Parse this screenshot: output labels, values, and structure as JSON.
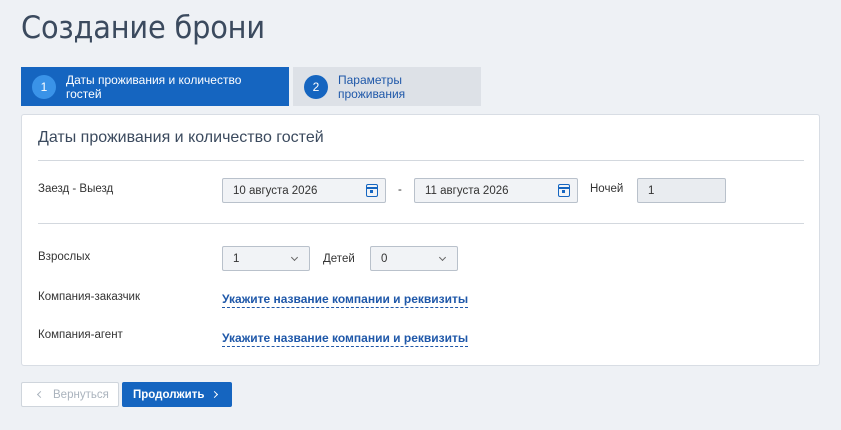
{
  "page": {
    "title": "Создание брони"
  },
  "steps": [
    {
      "number": "1",
      "label": "Даты проживания и количество гостей",
      "active": true
    },
    {
      "number": "2",
      "label": "Параметры проживания",
      "active": false
    }
  ],
  "panel": {
    "title": "Даты проживания и количество гостей",
    "dates": {
      "label": "Заезд - Выезд",
      "checkin": "10 августа 2026",
      "separator": "-",
      "checkout": "11 августа 2026",
      "nights_label": "Ночей",
      "nights_value": "1"
    },
    "adults": {
      "label": "Взрослых",
      "value": "1"
    },
    "children": {
      "label": "Детей",
      "value": "0"
    },
    "company_customer": {
      "label": "Компания-заказчик",
      "link": "Укажите название компании и реквизиты"
    },
    "company_agent": {
      "label": "Компания-агент",
      "link": "Укажите название компании и реквизиты"
    }
  },
  "buttons": {
    "back": "Вернуться",
    "next": "Продолжить"
  },
  "colors": {
    "primary": "#1565c0",
    "background": "#eef1f5",
    "link": "#1f58a9"
  }
}
